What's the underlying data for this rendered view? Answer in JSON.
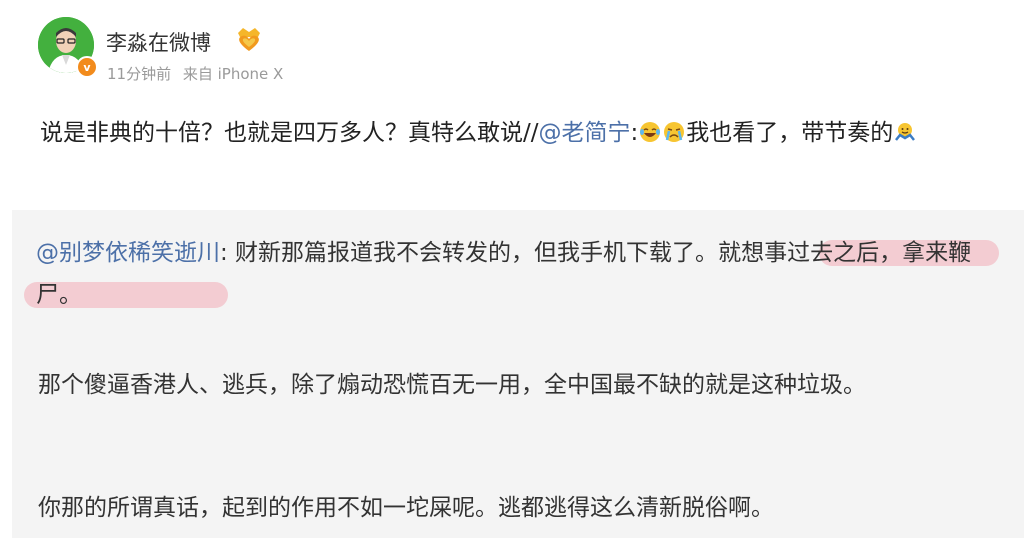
{
  "header": {
    "username": "李淼在微博",
    "time": "11分钟前",
    "source": "来自 iPhone X",
    "verified_label": "v",
    "member_badge_icon": "heart-crown-icon"
  },
  "post": {
    "text_before_mention": "说是非典的十倍？也就是四万多人？真特么敢说//",
    "mention": "@老简宁",
    "after_mention": ":",
    "emoji_1": "laugh-cry-emoji",
    "emoji_2": "cry-emoji",
    "text_after_emoji": "我也看了，带节奏的",
    "emoji_3": "shrug-emoji"
  },
  "repost": {
    "mention": "@别梦依稀笑逝川",
    "text_1": ": 财新那篇报道我不会转发的，但我手机下载了。",
    "highlighted": "就想事过去之后，拿来鞭尸。",
    "highlight_color": "#f08291",
    "paragraph_2": "那个傻逼香港人、逃兵，除了煽动恐慌百无一用，全中国最不缺的就是这种垃圾。",
    "paragraph_3": "你那的所谓真话，起到的作用不如一坨屎呢。逃都逃得这么清新脱俗啊。"
  },
  "colors": {
    "mention": "#4c70a8",
    "repost_bg": "#f4f4f4",
    "avatar_bg": "#43b03e",
    "verified_bg": "#f28b1c"
  }
}
